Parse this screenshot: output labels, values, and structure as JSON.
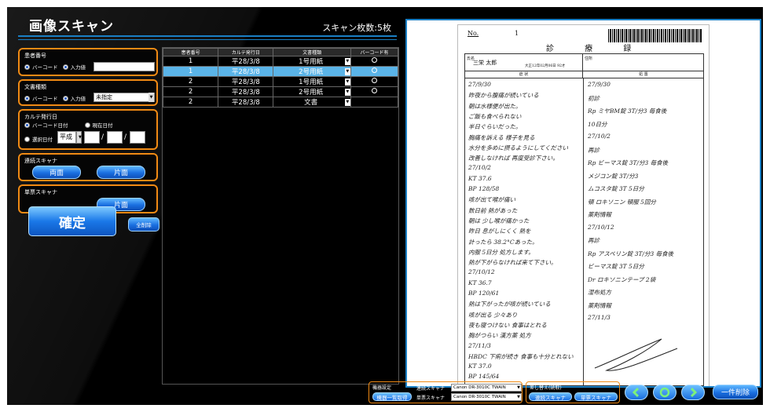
{
  "app": {
    "title": "画像スキャン",
    "scan_count": "スキャン枚数:5枚"
  },
  "patient": {
    "label": "患者番号",
    "opt_barcode": "バーコード",
    "opt_input": "入力値",
    "value": ""
  },
  "doc_type": {
    "label": "文書種類",
    "opt_barcode": "バーコード",
    "opt_input": "入力値",
    "selected": "未指定"
  },
  "karte_date": {
    "label": "カルテ発行日",
    "opt_barcode": "バーコード日付",
    "opt_today": "現在日付",
    "opt_select": "選択日付",
    "era": "平成",
    "sep1": "/",
    "sep2": "/"
  },
  "duplex": {
    "label": "連続スキャナ",
    "btn_both": "両面",
    "btn_single": "片面"
  },
  "single": {
    "label": "単票スキャナ",
    "btn_single": "片面"
  },
  "buttons": {
    "confirm": "確定",
    "clear_all": "全削除"
  },
  "table": {
    "headers": [
      "患者番号",
      "カルテ発行日",
      "文書種類",
      "バーコード有"
    ],
    "rows": [
      {
        "pid": "1",
        "date": "平28/3/8",
        "type": "1号用紙"
      },
      {
        "pid": "1",
        "date": "平28/3/8",
        "type": "2号用紙"
      },
      {
        "pid": "2",
        "date": "平28/3/8",
        "type": "1号用紙"
      },
      {
        "pid": "2",
        "date": "平28/3/8",
        "type": "2号用紙"
      },
      {
        "pid": "2",
        "date": "平28/3/8",
        "type": "文書"
      }
    ]
  },
  "document": {
    "no_label": "No.",
    "no_value": "1",
    "title": "診 療 録",
    "name_label": "氏名",
    "name": "三栄 太郎",
    "birth": "大正12年02月06日 92才",
    "address_label": "住所",
    "col_left": "症 状",
    "col_right": "処 置",
    "left_lines": [
      "27/9/30",
      "昨夜から腹痛が続いている",
      "朝は水様便が出た。",
      "ご飯も食べられない",
      "半日ぐらいだった。",
      "胸痛を訴える 様子を見る",
      "水分を多めに摂るようにしてください",
      "改善しなければ 再度受診下さい。",
      "27/10/2",
      "KT 37.6",
      "BP 128/58",
      "咳が出て喉が痛い",
      "数日前 熱があった",
      "朝は 少し喉が痛かった",
      "昨日 息がしにくく 熱を",
      "計ったら 38.2°Cあった。",
      "内服 5日分 処方します。",
      "熱が下がらなければ来て下さい。",
      "27/10/12",
      "KT 36.7",
      "BP 120/61",
      "熱は下がったが咳が続いている",
      "咳が出る 少々あり",
      "夜も寝つけない 食事はとれる",
      "胸がつらい 漢方薬 処方",
      "27/11/3",
      "HBDC 下痢が続き 食事も十分とれない",
      "KT 37.0",
      "BP 145/64"
    ],
    "right_lines": [
      "27/9/30",
      "初診",
      "Rp ミヤBM錠 3T/分3 毎食後",
      "10日分",
      "27/10/2",
      "再診",
      "Rp ビーマス錠 3T/分3 毎食後",
      "メジコン錠 3T/分3",
      "ムコスタ錠 3T 5日分",
      "頓 ロキソニン 頓服 5回分",
      "薬剤情報",
      "27/10/12",
      "再診",
      "Rp アスベリン錠 3T/分3 毎食後",
      "ビーマス錠 3T 5日分",
      "Dr ロキソニンテープ 2袋",
      "湿布処方",
      "薬剤情報",
      "27/11/3"
    ]
  },
  "footer": {
    "device_label": "機器設定",
    "device_list_btn": "機器一覧取得",
    "duplex_label": "連続スキャナ",
    "duplex_value": "Canon DR-3010C TWAIN",
    "single_label": "単票スキャナ",
    "single_value": "Canon DR-3010C TWAIN",
    "rescan_label": "差し替え(読取)",
    "rescan_duplex": "連続スキャナ",
    "rescan_single": "単票スキャナ",
    "delete_one": "一件削除"
  },
  "colors": {
    "accent_orange": "#f08a14",
    "accent_blue": "#1a6fe0",
    "selection": "#5ab4e8"
  }
}
